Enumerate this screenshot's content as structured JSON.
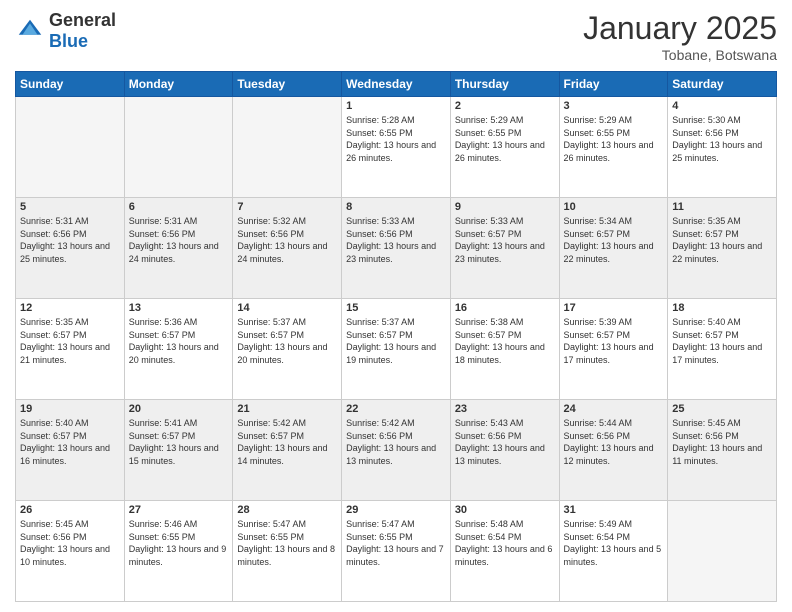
{
  "header": {
    "logo_general": "General",
    "logo_blue": "Blue",
    "month_title": "January 2025",
    "location": "Tobane, Botswana"
  },
  "weekdays": [
    "Sunday",
    "Monday",
    "Tuesday",
    "Wednesday",
    "Thursday",
    "Friday",
    "Saturday"
  ],
  "weeks": [
    [
      {
        "day": "",
        "sunrise": "",
        "sunset": "",
        "daylight": ""
      },
      {
        "day": "",
        "sunrise": "",
        "sunset": "",
        "daylight": ""
      },
      {
        "day": "",
        "sunrise": "",
        "sunset": "",
        "daylight": ""
      },
      {
        "day": "1",
        "sunrise": "Sunrise: 5:28 AM",
        "sunset": "Sunset: 6:55 PM",
        "daylight": "Daylight: 13 hours and 26 minutes."
      },
      {
        "day": "2",
        "sunrise": "Sunrise: 5:29 AM",
        "sunset": "Sunset: 6:55 PM",
        "daylight": "Daylight: 13 hours and 26 minutes."
      },
      {
        "day": "3",
        "sunrise": "Sunrise: 5:29 AM",
        "sunset": "Sunset: 6:55 PM",
        "daylight": "Daylight: 13 hours and 26 minutes."
      },
      {
        "day": "4",
        "sunrise": "Sunrise: 5:30 AM",
        "sunset": "Sunset: 6:56 PM",
        "daylight": "Daylight: 13 hours and 25 minutes."
      }
    ],
    [
      {
        "day": "5",
        "sunrise": "Sunrise: 5:31 AM",
        "sunset": "Sunset: 6:56 PM",
        "daylight": "Daylight: 13 hours and 25 minutes."
      },
      {
        "day": "6",
        "sunrise": "Sunrise: 5:31 AM",
        "sunset": "Sunset: 6:56 PM",
        "daylight": "Daylight: 13 hours and 24 minutes."
      },
      {
        "day": "7",
        "sunrise": "Sunrise: 5:32 AM",
        "sunset": "Sunset: 6:56 PM",
        "daylight": "Daylight: 13 hours and 24 minutes."
      },
      {
        "day": "8",
        "sunrise": "Sunrise: 5:33 AM",
        "sunset": "Sunset: 6:56 PM",
        "daylight": "Daylight: 13 hours and 23 minutes."
      },
      {
        "day": "9",
        "sunrise": "Sunrise: 5:33 AM",
        "sunset": "Sunset: 6:57 PM",
        "daylight": "Daylight: 13 hours and 23 minutes."
      },
      {
        "day": "10",
        "sunrise": "Sunrise: 5:34 AM",
        "sunset": "Sunset: 6:57 PM",
        "daylight": "Daylight: 13 hours and 22 minutes."
      },
      {
        "day": "11",
        "sunrise": "Sunrise: 5:35 AM",
        "sunset": "Sunset: 6:57 PM",
        "daylight": "Daylight: 13 hours and 22 minutes."
      }
    ],
    [
      {
        "day": "12",
        "sunrise": "Sunrise: 5:35 AM",
        "sunset": "Sunset: 6:57 PM",
        "daylight": "Daylight: 13 hours and 21 minutes."
      },
      {
        "day": "13",
        "sunrise": "Sunrise: 5:36 AM",
        "sunset": "Sunset: 6:57 PM",
        "daylight": "Daylight: 13 hours and 20 minutes."
      },
      {
        "day": "14",
        "sunrise": "Sunrise: 5:37 AM",
        "sunset": "Sunset: 6:57 PM",
        "daylight": "Daylight: 13 hours and 20 minutes."
      },
      {
        "day": "15",
        "sunrise": "Sunrise: 5:37 AM",
        "sunset": "Sunset: 6:57 PM",
        "daylight": "Daylight: 13 hours and 19 minutes."
      },
      {
        "day": "16",
        "sunrise": "Sunrise: 5:38 AM",
        "sunset": "Sunset: 6:57 PM",
        "daylight": "Daylight: 13 hours and 18 minutes."
      },
      {
        "day": "17",
        "sunrise": "Sunrise: 5:39 AM",
        "sunset": "Sunset: 6:57 PM",
        "daylight": "Daylight: 13 hours and 17 minutes."
      },
      {
        "day": "18",
        "sunrise": "Sunrise: 5:40 AM",
        "sunset": "Sunset: 6:57 PM",
        "daylight": "Daylight: 13 hours and 17 minutes."
      }
    ],
    [
      {
        "day": "19",
        "sunrise": "Sunrise: 5:40 AM",
        "sunset": "Sunset: 6:57 PM",
        "daylight": "Daylight: 13 hours and 16 minutes."
      },
      {
        "day": "20",
        "sunrise": "Sunrise: 5:41 AM",
        "sunset": "Sunset: 6:57 PM",
        "daylight": "Daylight: 13 hours and 15 minutes."
      },
      {
        "day": "21",
        "sunrise": "Sunrise: 5:42 AM",
        "sunset": "Sunset: 6:57 PM",
        "daylight": "Daylight: 13 hours and 14 minutes."
      },
      {
        "day": "22",
        "sunrise": "Sunrise: 5:42 AM",
        "sunset": "Sunset: 6:56 PM",
        "daylight": "Daylight: 13 hours and 13 minutes."
      },
      {
        "day": "23",
        "sunrise": "Sunrise: 5:43 AM",
        "sunset": "Sunset: 6:56 PM",
        "daylight": "Daylight: 13 hours and 13 minutes."
      },
      {
        "day": "24",
        "sunrise": "Sunrise: 5:44 AM",
        "sunset": "Sunset: 6:56 PM",
        "daylight": "Daylight: 13 hours and 12 minutes."
      },
      {
        "day": "25",
        "sunrise": "Sunrise: 5:45 AM",
        "sunset": "Sunset: 6:56 PM",
        "daylight": "Daylight: 13 hours and 11 minutes."
      }
    ],
    [
      {
        "day": "26",
        "sunrise": "Sunrise: 5:45 AM",
        "sunset": "Sunset: 6:56 PM",
        "daylight": "Daylight: 13 hours and 10 minutes."
      },
      {
        "day": "27",
        "sunrise": "Sunrise: 5:46 AM",
        "sunset": "Sunset: 6:55 PM",
        "daylight": "Daylight: 13 hours and 9 minutes."
      },
      {
        "day": "28",
        "sunrise": "Sunrise: 5:47 AM",
        "sunset": "Sunset: 6:55 PM",
        "daylight": "Daylight: 13 hours and 8 minutes."
      },
      {
        "day": "29",
        "sunrise": "Sunrise: 5:47 AM",
        "sunset": "Sunset: 6:55 PM",
        "daylight": "Daylight: 13 hours and 7 minutes."
      },
      {
        "day": "30",
        "sunrise": "Sunrise: 5:48 AM",
        "sunset": "Sunset: 6:54 PM",
        "daylight": "Daylight: 13 hours and 6 minutes."
      },
      {
        "day": "31",
        "sunrise": "Sunrise: 5:49 AM",
        "sunset": "Sunset: 6:54 PM",
        "daylight": "Daylight: 13 hours and 5 minutes."
      },
      {
        "day": "",
        "sunrise": "",
        "sunset": "",
        "daylight": ""
      }
    ]
  ]
}
